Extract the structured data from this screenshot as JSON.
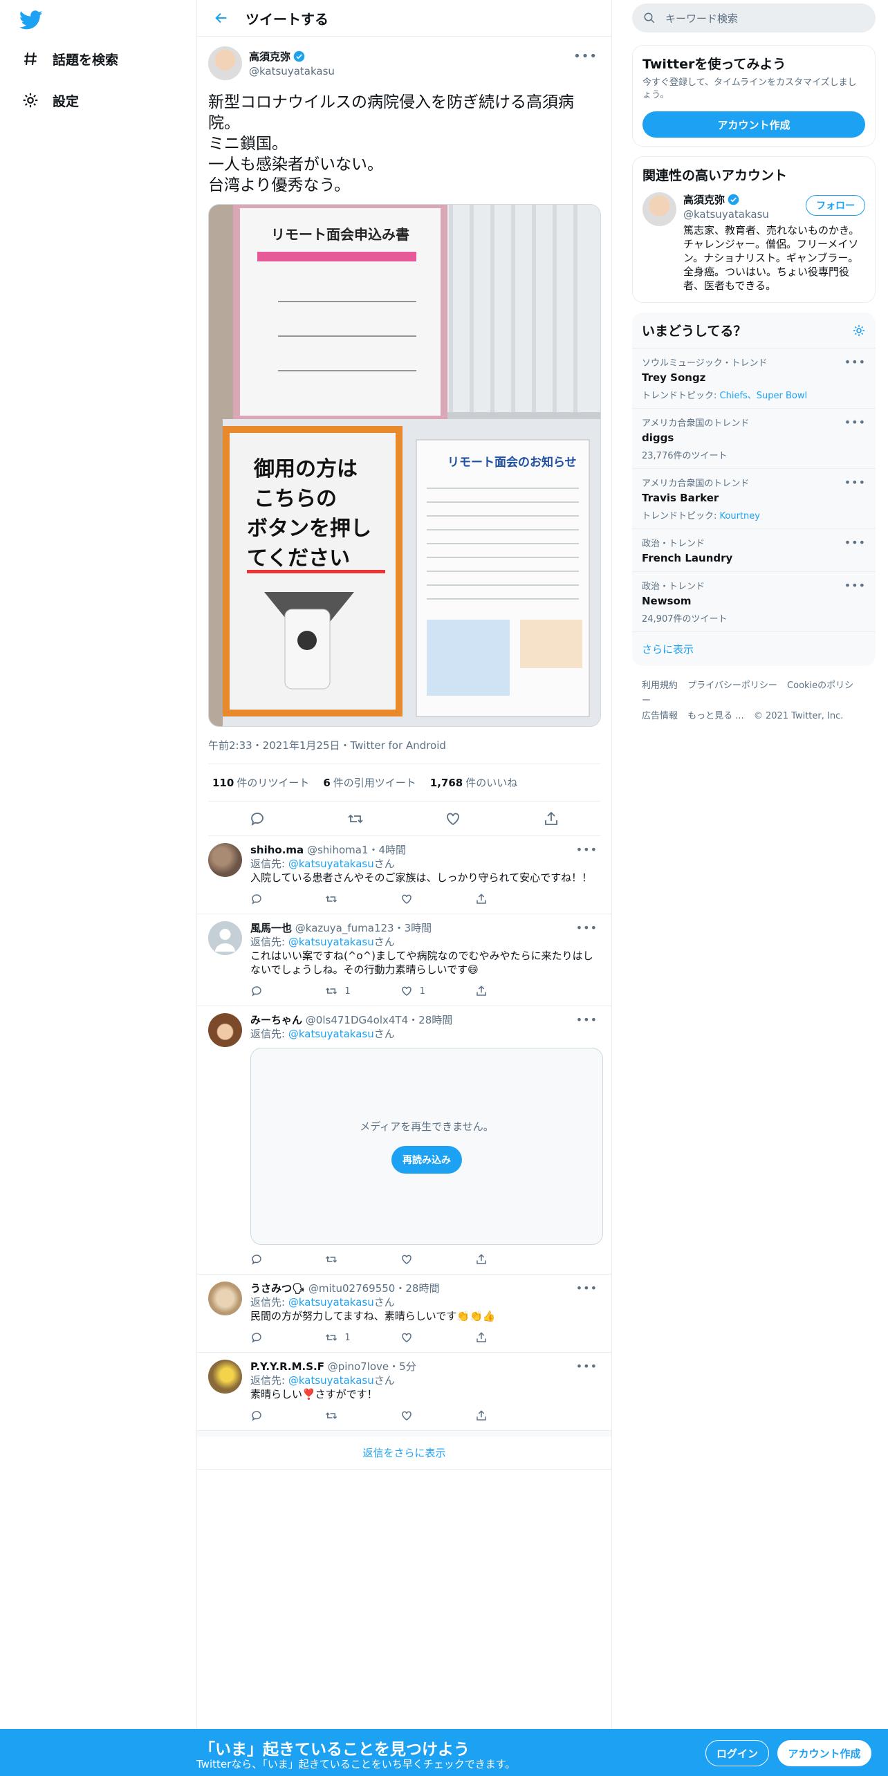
{
  "nav": {
    "items": [
      {
        "label": "話題を検索",
        "icon": "hashtag-icon"
      },
      {
        "label": "設定",
        "icon": "gear-icon"
      }
    ]
  },
  "header": {
    "title": "ツイートする"
  },
  "tweet": {
    "author_name": "高須克弥",
    "author_handle": "@katsuyatakasu",
    "text": "新型コロナウイルスの病院侵入を防ぎ続ける高須病院。\nミニ鎖国。\n一人も感染者がいない。\n台湾より優秀なう。",
    "photo_texts": [
      "リモート面会申込み書",
      "御用の方は",
      "こちらの",
      "ボタンを押し",
      "てください",
      "リモート面会のお知らせ"
    ],
    "meta": "午前2:33・2021年1月25日・Twitter for Android",
    "stats": [
      {
        "count": "110",
        "label": "件のリツイート"
      },
      {
        "count": "6",
        "label": "件の引用ツイート"
      },
      {
        "count": "1,768",
        "label": "件のいいね"
      }
    ]
  },
  "replies": [
    {
      "name": "shiho.ma",
      "handle": "@shihoma1",
      "time": "4時間",
      "reply_to_prefix": "返信先: ",
      "reply_to": "@katsuyatakasu",
      "reply_to_suffix": "さん",
      "text": "入院している患者さんやそのご家族は、しっかり守られて安心ですね！！",
      "retweets": "",
      "likes": ""
    },
    {
      "name": "風馬一也",
      "handle": "@kazuya_fuma123",
      "time": "3時間",
      "reply_to_prefix": "返信先: ",
      "reply_to": "@katsuyatakasu",
      "reply_to_suffix": "さん",
      "text": "これはいい案ですね(^o^)ましてや病院なのでむやみやたらに来たりはしないでしょうしね。その行動力素晴らしいです😄",
      "retweets": "1",
      "likes": "1"
    },
    {
      "name": "みーちゃん",
      "handle": "@0ls471DG4olx4T4",
      "time": "28時間",
      "reply_to_prefix": "返信先: ",
      "reply_to": "@katsuyatakasu",
      "reply_to_suffix": "さん",
      "media_msg": "メディアを再生できません。",
      "reload": "再読み込み",
      "retweets": "",
      "likes": ""
    },
    {
      "name": "うさみつ🗣",
      "handle": "@mitu02769550",
      "time": "28時間",
      "reply_to_prefix": "返信先: ",
      "reply_to": "@katsuyatakasu",
      "reply_to_suffix": "さん",
      "text": "民間の方が努力してますね、素晴らしいです👏👏👍",
      "retweets": "1",
      "likes": ""
    },
    {
      "name": "P.Y.Y.R.M.S.F",
      "handle": "@pino7love",
      "time": "5分",
      "reply_to_prefix": "返信先: ",
      "reply_to": "@katsuyatakasu",
      "reply_to_suffix": "さん",
      "text": "素晴らしい❣️さすがです！",
      "retweets": "",
      "likes": ""
    }
  ],
  "show_more_replies": "返信をさらに表示",
  "search": {
    "placeholder": "キーワード検索"
  },
  "signup_card": {
    "title": "Twitterを使ってみよう",
    "sub": "今すぐ登録して、タイムラインをカスタマイズしましょう。",
    "button": "アカウント作成"
  },
  "related": {
    "title": "関連性の高いアカウント",
    "name": "高須克弥",
    "handle": "@katsuyatakasu",
    "follow": "フォロー",
    "bio": "篤志家、教育者、売れないものかき。チャレンジャー。僧侶。フリーメイソン。ナショナリスト。ギャンブラー。全身癌。ついはい。ちょい役専門役者、医者もできる。"
  },
  "trends": {
    "title": "いまどうしてる？",
    "items": [
      {
        "context": "ソウルミュージック・トレンド",
        "name": "Trey Songz",
        "extra_prefix": "トレンドトピック: ",
        "extra_links": "Chiefs、Super Bowl",
        "extra": ""
      },
      {
        "context": "アメリカ合衆国のトレンド",
        "name": "diggs",
        "extra_prefix": "",
        "extra_links": "",
        "extra": "23,776件のツイート"
      },
      {
        "context": "アメリカ合衆国のトレンド",
        "name": "Travis Barker",
        "extra_prefix": "トレンドトピック: ",
        "extra_links": "Kourtney",
        "extra": ""
      },
      {
        "context": "政治・トレンド",
        "name": "French Laundry",
        "extra_prefix": "",
        "extra_links": "",
        "extra": ""
      },
      {
        "context": "政治・トレンド",
        "name": "Newsom",
        "extra_prefix": "",
        "extra_links": "",
        "extra": "24,907件のツイート"
      }
    ],
    "show_more": "さらに表示"
  },
  "footer": {
    "links": [
      "利用規約",
      "プライバシーポリシー",
      "Cookieのポリシー",
      "広告情報",
      "もっと見る ..."
    ],
    "copyright": "© 2021 Twitter, Inc."
  },
  "bottom_bar": {
    "title": "「いま」起きていることを見つけよう",
    "sub": "Twitterなら、「いま」起きていることをいち早くチェックできます。",
    "login": "ログイン",
    "signup": "アカウント作成"
  },
  "colors": {
    "brand": "#1da1f2",
    "text": "#0f1419",
    "muted": "#5b7083"
  }
}
